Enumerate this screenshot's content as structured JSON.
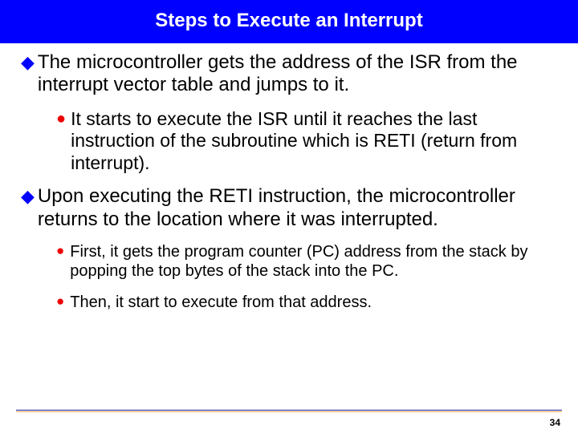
{
  "slide": {
    "title": "Steps to Execute an Interrupt",
    "bullets": {
      "b1a": "The microcontroller gets the address of the ISR from the interrupt vector table and jumps to it.",
      "b2a": "It starts to execute the ISR until it reaches the last instruction of the subroutine  which is RETI (return from interrupt).",
      "b1b": "Upon executing the RETI instruction, the microcontroller returns to the location where it was interrupted.",
      "b3a": "First, it gets the program counter (PC) address from the stack by popping the top bytes of the stack into the PC.",
      "b3b": "Then, it start to execute from that address."
    },
    "page_number": "34"
  }
}
